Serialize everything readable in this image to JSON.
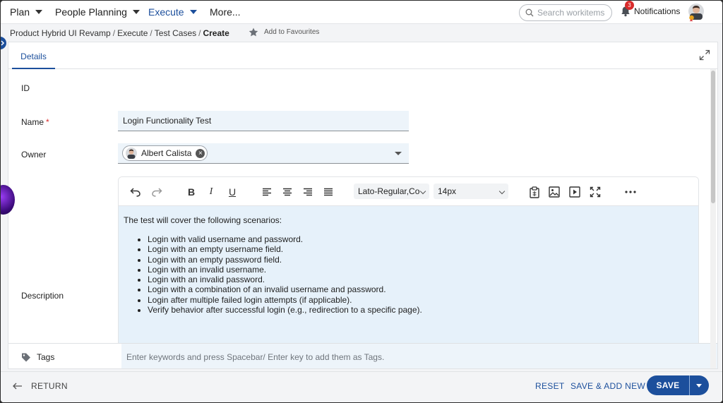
{
  "nav": {
    "items": [
      {
        "label": "Plan",
        "has_caret": true,
        "active": false
      },
      {
        "label": "People Planning",
        "has_caret": true,
        "active": false
      },
      {
        "label": "Execute",
        "has_caret": true,
        "active": true
      },
      {
        "label": "More...",
        "has_caret": false,
        "active": false
      }
    ],
    "search_placeholder": "Search workitems",
    "notifications_label": "Notifications",
    "notifications_count": "3"
  },
  "breadcrumb": {
    "items": [
      "Product Hybrid UI Revamp",
      "Execute",
      "Test Cases"
    ],
    "separator": "/",
    "current": "Create",
    "favourite_label": "Add to Favourites"
  },
  "tabs": {
    "active": "Details"
  },
  "form": {
    "id_label": "ID",
    "name_label": "Name",
    "name_required_mark": "*",
    "name_value": "Login Functionality Test",
    "owner_label": "Owner",
    "owner_value": "Albert Calista",
    "description_label": "Description"
  },
  "editor": {
    "font_family": "Lato-Regular,Co",
    "font_size": "14px",
    "intro": "The test will cover the following scenarios:",
    "bullets": [
      "Login with valid username and password.",
      "Login with an empty username field.",
      "Login with an empty password field.",
      "Login with an invalid username.",
      "Login with an invalid password.",
      "Login with a combination of an invalid username and password.",
      "Login after multiple failed login attempts (if applicable).",
      "Verify behavior after successful login (e.g., redirection to a specific page)."
    ]
  },
  "tags": {
    "label": "Tags",
    "placeholder": "Enter keywords and press Spacebar/ Enter key to add them as Tags."
  },
  "footer": {
    "return_label": "RETURN",
    "reset_label": "RESET",
    "save_add_new_label": "SAVE & ADD NEW",
    "save_label": "SAVE"
  },
  "colors": {
    "accent": "#1c4f9c",
    "field_bg": "#edf4fa",
    "editor_bg": "#e6f1fa",
    "badge": "#d92b2b"
  }
}
